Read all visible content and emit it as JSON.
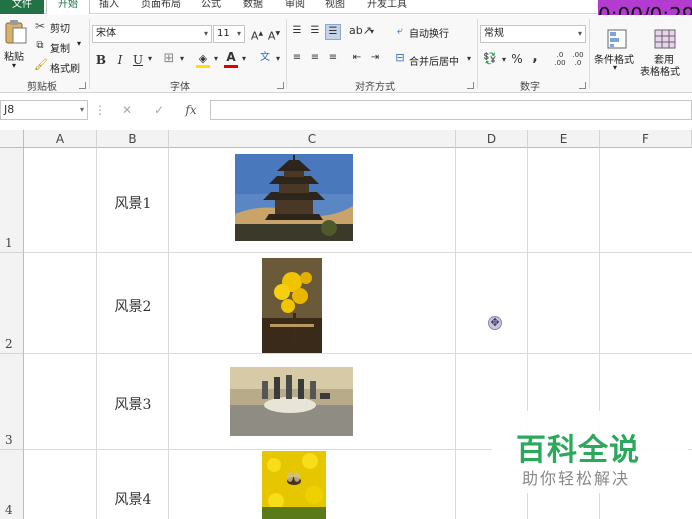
{
  "ribbon_tabs": [
    {
      "label": "文件"
    },
    {
      "label": "开始"
    },
    {
      "label": "插入"
    },
    {
      "label": "页面布局"
    },
    {
      "label": "公式"
    },
    {
      "label": "数据"
    },
    {
      "label": "审阅"
    },
    {
      "label": "视图"
    },
    {
      "label": "开发工具"
    }
  ],
  "timer": "0:00/0:29",
  "clipboard": {
    "paste": "粘贴",
    "cut": "剪切",
    "copy": "复制",
    "format_painter": "格式刷",
    "group": "剪贴板"
  },
  "font": {
    "name": "宋体",
    "size": "11",
    "grow": "A",
    "shrink": "A",
    "bold": "B",
    "italic": "I",
    "underline": "U",
    "font_color": "A",
    "phonetic": "文",
    "group": "字体"
  },
  "alignment": {
    "wrap_text": "自动换行",
    "merge_center": "合并后居中",
    "group": "对齐方式"
  },
  "number": {
    "format": "常规",
    "percent": "%",
    "comma": ",",
    "group": "数字"
  },
  "styles": {
    "conditional_format": "条件格式",
    "table_style": "套用",
    "table_style_2": "表格格式"
  },
  "formula_bar": {
    "name_box": "J8",
    "cancel": "✕",
    "enter": "✓",
    "fx": "fx",
    "formula": ""
  },
  "columns": [
    "A",
    "B",
    "C",
    "D",
    "E",
    "F"
  ],
  "rows": [
    {
      "number": "1",
      "b_text": "风景1"
    },
    {
      "number": "2",
      "b_text": "风景2"
    },
    {
      "number": "3",
      "b_text": "风景3"
    },
    {
      "number": "4",
      "b_text": "风景4"
    }
  ],
  "watermark": {
    "title": "百科全说",
    "subtitle": "助你轻松解决"
  }
}
